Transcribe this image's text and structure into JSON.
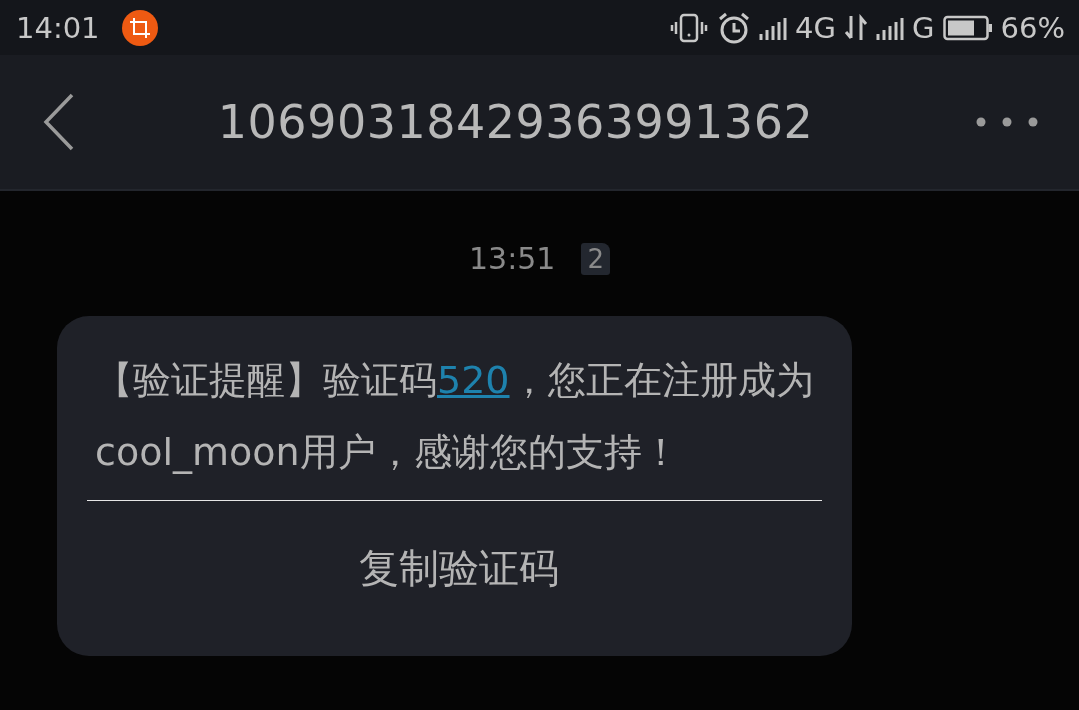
{
  "status_bar": {
    "time": "14:01",
    "network_1": "4G",
    "network_2": "G",
    "battery": "66%"
  },
  "header": {
    "title": "10690318429363991362"
  },
  "conversation": {
    "timestamp": "13:51",
    "sim_badge": "2",
    "messages": [
      {
        "text_before": "【验证提醒】验证码",
        "code": "520",
        "text_after": "，您正在注册成为cool_moon用户，感谢您的支持！",
        "action": "复制验证码"
      }
    ]
  }
}
